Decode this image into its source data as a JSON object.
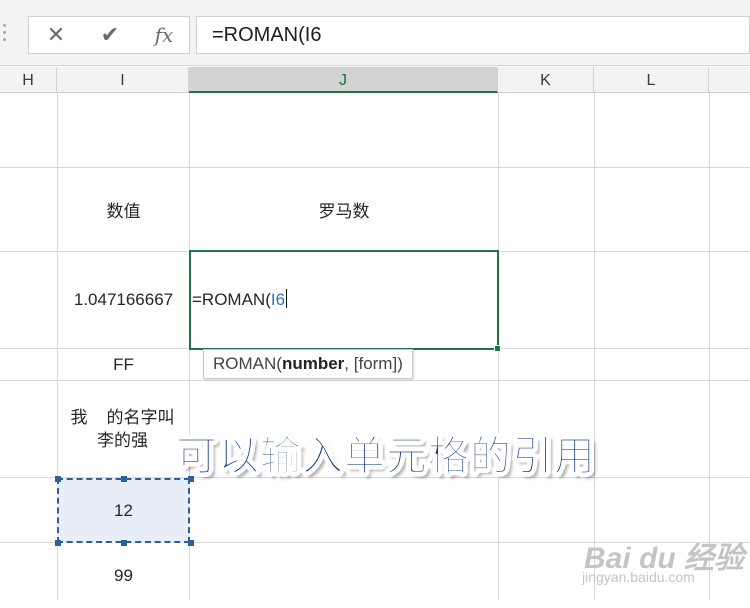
{
  "formula_bar": {
    "cancel_glyph": "✕",
    "enter_glyph": "✔",
    "fx_label": "fx",
    "formula": "=ROMAN(I6"
  },
  "columns": [
    "H",
    "I",
    "J",
    "K",
    "L"
  ],
  "selected_column": "J",
  "cells": {
    "i_header": "数值",
    "j_header": "罗马数",
    "i_value1": "1.047166667",
    "i_value2": "FF",
    "i_value3": "我    的名字叫 李的强",
    "i_value4": "12",
    "i_value5": "99"
  },
  "editing": {
    "prefix": "=ROMAN(",
    "reference": "I6"
  },
  "tooltip": {
    "func": "ROMAN(",
    "arg_bold": "number",
    "rest": ", [form])"
  },
  "caption": "可以输入单元格的引用",
  "watermark": {
    "brand": "Bai du 经验",
    "url": "jingyan.baidu.com"
  },
  "colors": {
    "excel_green": "#217346",
    "reference_blue": "#2f6fbf",
    "copy_border": "#2f5f97",
    "caption_blue": "#143c8a"
  },
  "icons": [
    "cancel-icon",
    "enter-check-icon",
    "function-fx-icon"
  ]
}
